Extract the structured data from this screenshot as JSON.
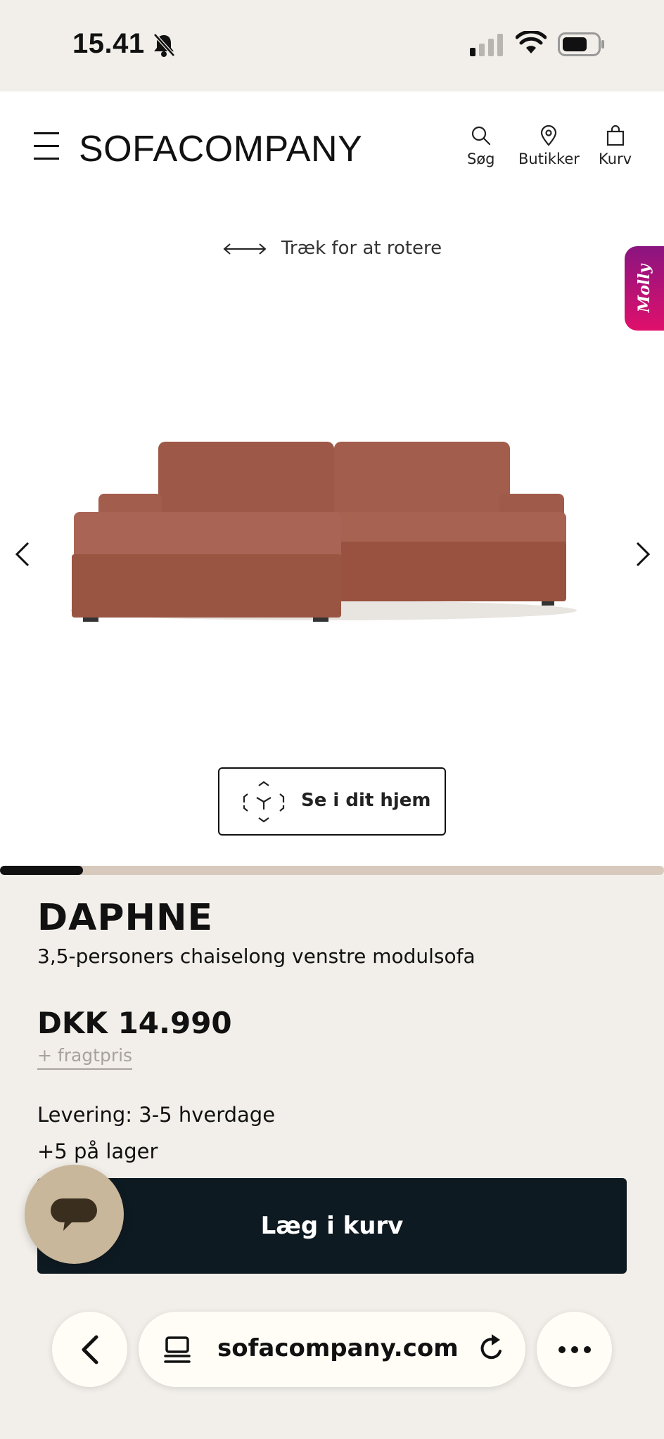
{
  "status_bar": {
    "time": "15.41"
  },
  "header": {
    "logo": "SOFACOMPANY",
    "search_label": "Søg",
    "stores_label": "Butikker",
    "cart_label": "Kurv"
  },
  "stage": {
    "rotate_hint": "Træk for at rotere",
    "molly_label": "Molly",
    "ar_button_label": "Se i dit hjem",
    "gallery_progress": 0.125
  },
  "product": {
    "name": "DAPHNE",
    "subtitle": "3,5-personers chaiselong venstre modulsofa",
    "price": "DKK 14.990",
    "freight_link": "+ fragtpris",
    "delivery": "Levering: 3-5 hverdage",
    "stock": "+5  på lager",
    "add_to_cart_label": "Læg i kurv"
  },
  "browser": {
    "url": "sofacompany.com"
  },
  "colors": {
    "background": "#f2efea",
    "cart_button": "#0e1a22",
    "chat_button": "#c9b79c",
    "molly_gradient_start": "#8a1480",
    "molly_gradient_end": "#e0106c",
    "sofa_fabric": "#a05a4a"
  },
  "icons": {
    "menu": "hamburger-icon",
    "search": "search-icon",
    "stores": "location-pin-icon",
    "cart": "shopping-bag-icon",
    "rotate": "double-arrow-icon",
    "ar": "ar-cube-icon",
    "chat": "chat-bubble-icon",
    "back": "chevron-left-icon",
    "reload": "reload-icon",
    "more": "more-dots-icon"
  }
}
